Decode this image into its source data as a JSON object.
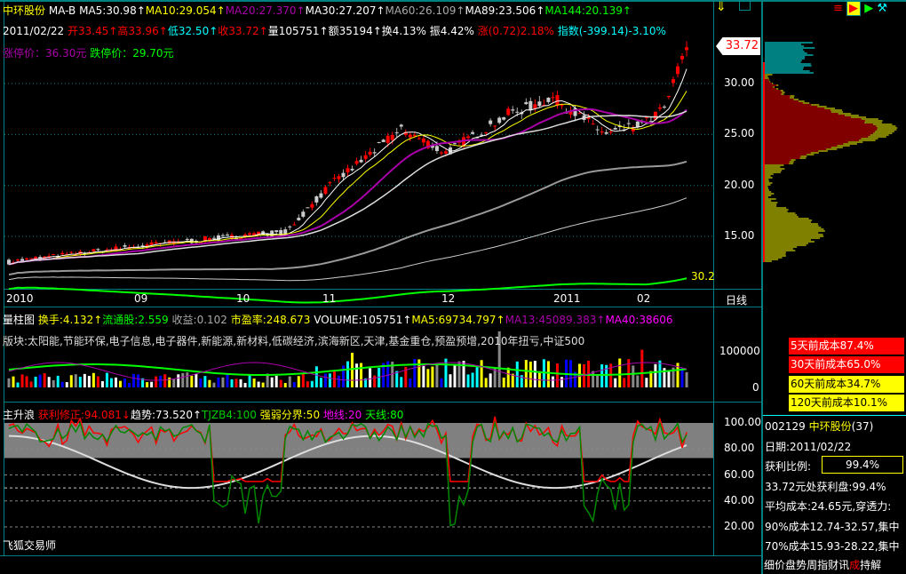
{
  "header": {
    "stock_name": "中环股份",
    "ma_label": "MA-B",
    "ma5": "MA5:30.98↑",
    "ma10": "MA10:29.054↑",
    "ma20": "MA20:27.370↑",
    "ma30": "MA30:27.207↑",
    "ma60": "MA60:26.109↑",
    "ma89": "MA89:23.506↑",
    "ma144": "MA144:20.139↑"
  },
  "quote": {
    "date": "2011/02/22",
    "open": "开33.45↑",
    "high": "高33.96↑",
    "low": "低32.50↑",
    "close": "收33.72↑",
    "volume": "量105751↑",
    "amount": "额35194↑",
    "turnover": "换4.13%",
    "amplitude": "振4.42%",
    "change": "涨(0.72)2.18%",
    "index": "指数(-399.14)-3.10%"
  },
  "limits": {
    "up": "涨停价：36.30元",
    "down": "跌停价：29.70元"
  },
  "price_axis": {
    "current": "33.72",
    "ticks": [
      "30.00",
      "25.00",
      "20.00",
      "15.00"
    ],
    "low_label": "30.2"
  },
  "date_axis": {
    "labels": [
      "2010",
      "09",
      "10",
      "11",
      "12",
      "2011",
      "02"
    ],
    "period": "日线"
  },
  "volume_panel": {
    "title": "量柱图",
    "turnover": "换手:4.132↑",
    "float": "流通股:2.559",
    "eps": "收益:0.102",
    "pe": "市盈率:248.673",
    "volume": "VOLUME:105751↑",
    "ma5": "MA5:69734.797↑",
    "ma13": "MA13:45089.383↑",
    "ma40": "MA40:38606",
    "sectors": "版块:太阳能,节能环保,电子信息,电子器件,新能源,新材料,低碳经济,滨海新区,天津,基金重仓,预盈预增,2010年扭亏,中证500",
    "ticks": [
      "100000",
      "0"
    ]
  },
  "indicator_panel": {
    "title": "主升浪",
    "profit": "获利修正:94.081↓",
    "trend": "趋势:73.520↑",
    "tjzb4": "TJZB4:100",
    "divider": "强弱分界:50",
    "ground": "地线:20",
    "sky": "天线:80",
    "ticks": [
      "100.00",
      "80.00",
      "60.00",
      "40.00",
      "20.00"
    ],
    "watermark": "飞狐交易师"
  },
  "cost_boxes": [
    "5天前成本87.4%",
    "30天前成本65.0%",
    "60天前成本34.7%",
    "120天前成本10.1%"
  ],
  "chip_info": {
    "code": "002129",
    "name": "中环股份",
    "count": "(37)",
    "date": "日期:2011/02/22",
    "profit_label": "获利比例:",
    "profit_value": "99.4%",
    "at_price": "33.72元处获利盘:99.4%",
    "avg_cost": "平均成本:24.65元,穿透力:",
    "c90": "90%成本12.74-32.57,集中",
    "c70": "70%成本15.93-28.22,集中"
  },
  "bottom_tabs": [
    "细",
    "价",
    "盘",
    "势",
    "周",
    "指",
    "财",
    "讯",
    "成",
    "持",
    "解"
  ],
  "price_path": [
    [
      0,
      12.5
    ],
    [
      28,
      14
    ],
    [
      55,
      15.2
    ],
    [
      62,
      15.4
    ],
    [
      72,
      20
    ],
    [
      88,
      25.5
    ],
    [
      98,
      23.2
    ],
    [
      112,
      27
    ],
    [
      122,
      28.6
    ],
    [
      134,
      25
    ],
    [
      142,
      26
    ],
    [
      147,
      27.5
    ],
    [
      152,
      33.7
    ]
  ],
  "colors": {
    "up": "#ff0000",
    "down": "#00ffff",
    "grid": "#008080"
  }
}
